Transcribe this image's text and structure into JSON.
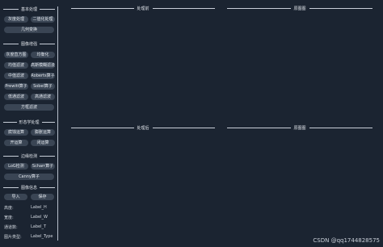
{
  "sections": {
    "basic": "基本处理",
    "enhance": "图像增强",
    "morph": "形态学处理",
    "edge": "边缘检测",
    "info": "图像信息"
  },
  "buttons": {
    "grayscale": "灰度处理",
    "binarize": "二值化处理",
    "geometric": "几何变换",
    "hist_eq": "灰度直方图",
    "equalize": "均衡化",
    "mean_filter": "均值滤波",
    "median_blur": "高斯模糊滤波",
    "median_filter": "中值滤波",
    "roberts": "Roberts算子",
    "prewitt": "Prewitt算子",
    "sobel": "Sobel算子",
    "lowpass": "低通滤波",
    "highpass": "高通滤波",
    "directional": "方框滤波",
    "erode": "腐蚀运算",
    "dilate": "膨胀运算",
    "open": "开运算",
    "close": "闭运算",
    "log": "LoG检测",
    "scharr": "Scharr算子",
    "canny": "Canny算子",
    "import": "导入",
    "save": "保存"
  },
  "info": {
    "height_label": "高度:",
    "height_value": "Label_H",
    "width_label": "宽度:",
    "width_value": "Label_W",
    "channels_label": "通道数:",
    "channels_value": "Label_T",
    "type_label": "图片类型:",
    "type_value": "Label_Type"
  },
  "panels": {
    "top_left": "处理前",
    "top_right": "原图图",
    "bottom_left": "处理后",
    "bottom_right": "原图图"
  },
  "watermark": "CSDN @qq1744828575"
}
